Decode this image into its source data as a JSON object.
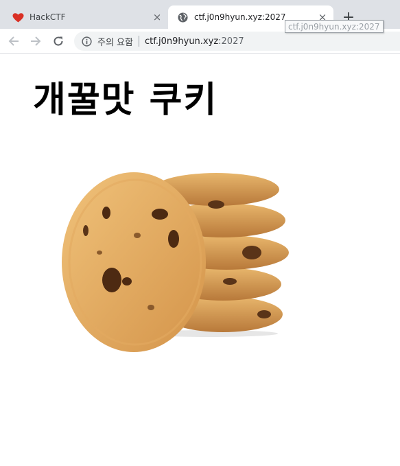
{
  "tabs": [
    {
      "title": "HackCTF",
      "favicon": "heart-icon",
      "active": false
    },
    {
      "title": "ctf.j0n9hyun.xyz:2027",
      "favicon": "globe-icon",
      "active": true
    }
  ],
  "new_tab_label": "+",
  "close_label": "×",
  "tooltip": "ctf.j0n9hyun.xyz:2027",
  "address_bar": {
    "security_text": "주의 요함",
    "host": "ctf.j0n9hyun.xyz",
    "port": ":2027"
  },
  "page": {
    "heading": "개꿀맛 쿠키",
    "image": "cookie-stack-image"
  },
  "colors": {
    "heart": "#d93025",
    "tabstrip": "#dee1e6",
    "cookie": "#e0a855"
  }
}
